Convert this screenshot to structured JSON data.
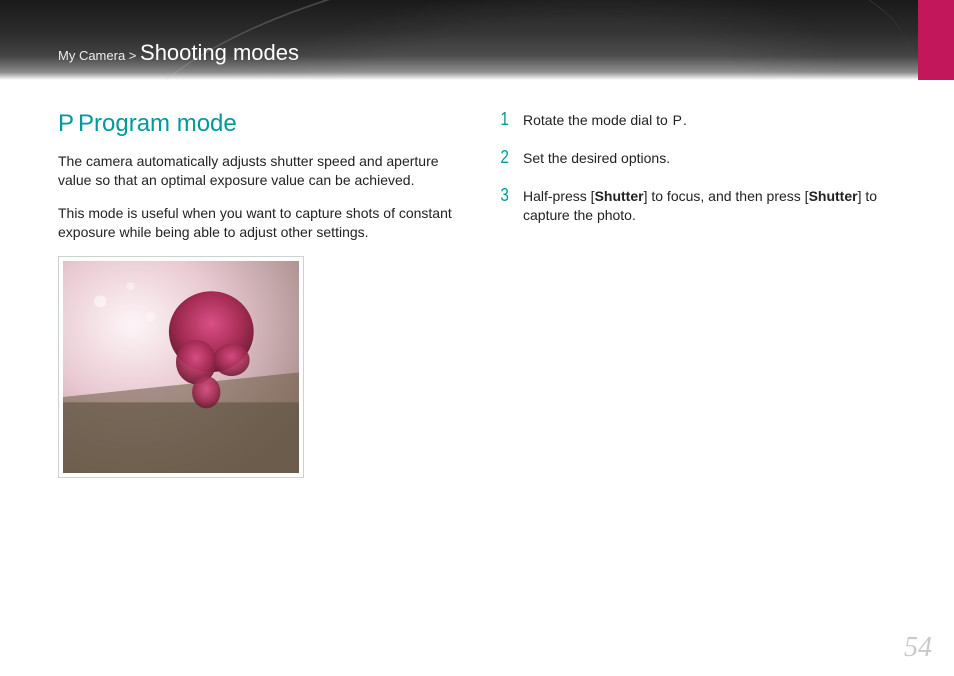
{
  "header": {
    "breadcrumb_prefix": "My Camera",
    "breadcrumb_sep": " > ",
    "section_title": "Shooting modes"
  },
  "left": {
    "mode_icon_letter": "P",
    "title": "Program mode",
    "para1": "The camera automatically adjusts shutter speed and aperture value so that an optimal exposure value can be achieved.",
    "para2": "This mode is useful when you want to capture shots of constant exposure while being able to adjust other settings.",
    "photo_alt": "sample-photo-foliage"
  },
  "right": {
    "steps": [
      {
        "num": "1",
        "pre": "Rotate the mode dial to ",
        "icon": "P",
        "post": "."
      },
      {
        "num": "2",
        "pre": "Set the desired options.",
        "icon": "",
        "post": ""
      },
      {
        "num": "3",
        "pre": "Half-press [",
        "b1": "Shutter",
        "mid": "] to focus, and then press [",
        "b2": "Shutter",
        "post": "] to capture the photo."
      }
    ]
  },
  "page_number": "54",
  "colors": {
    "accent": "#009a9a",
    "tab": "#c2185b"
  }
}
